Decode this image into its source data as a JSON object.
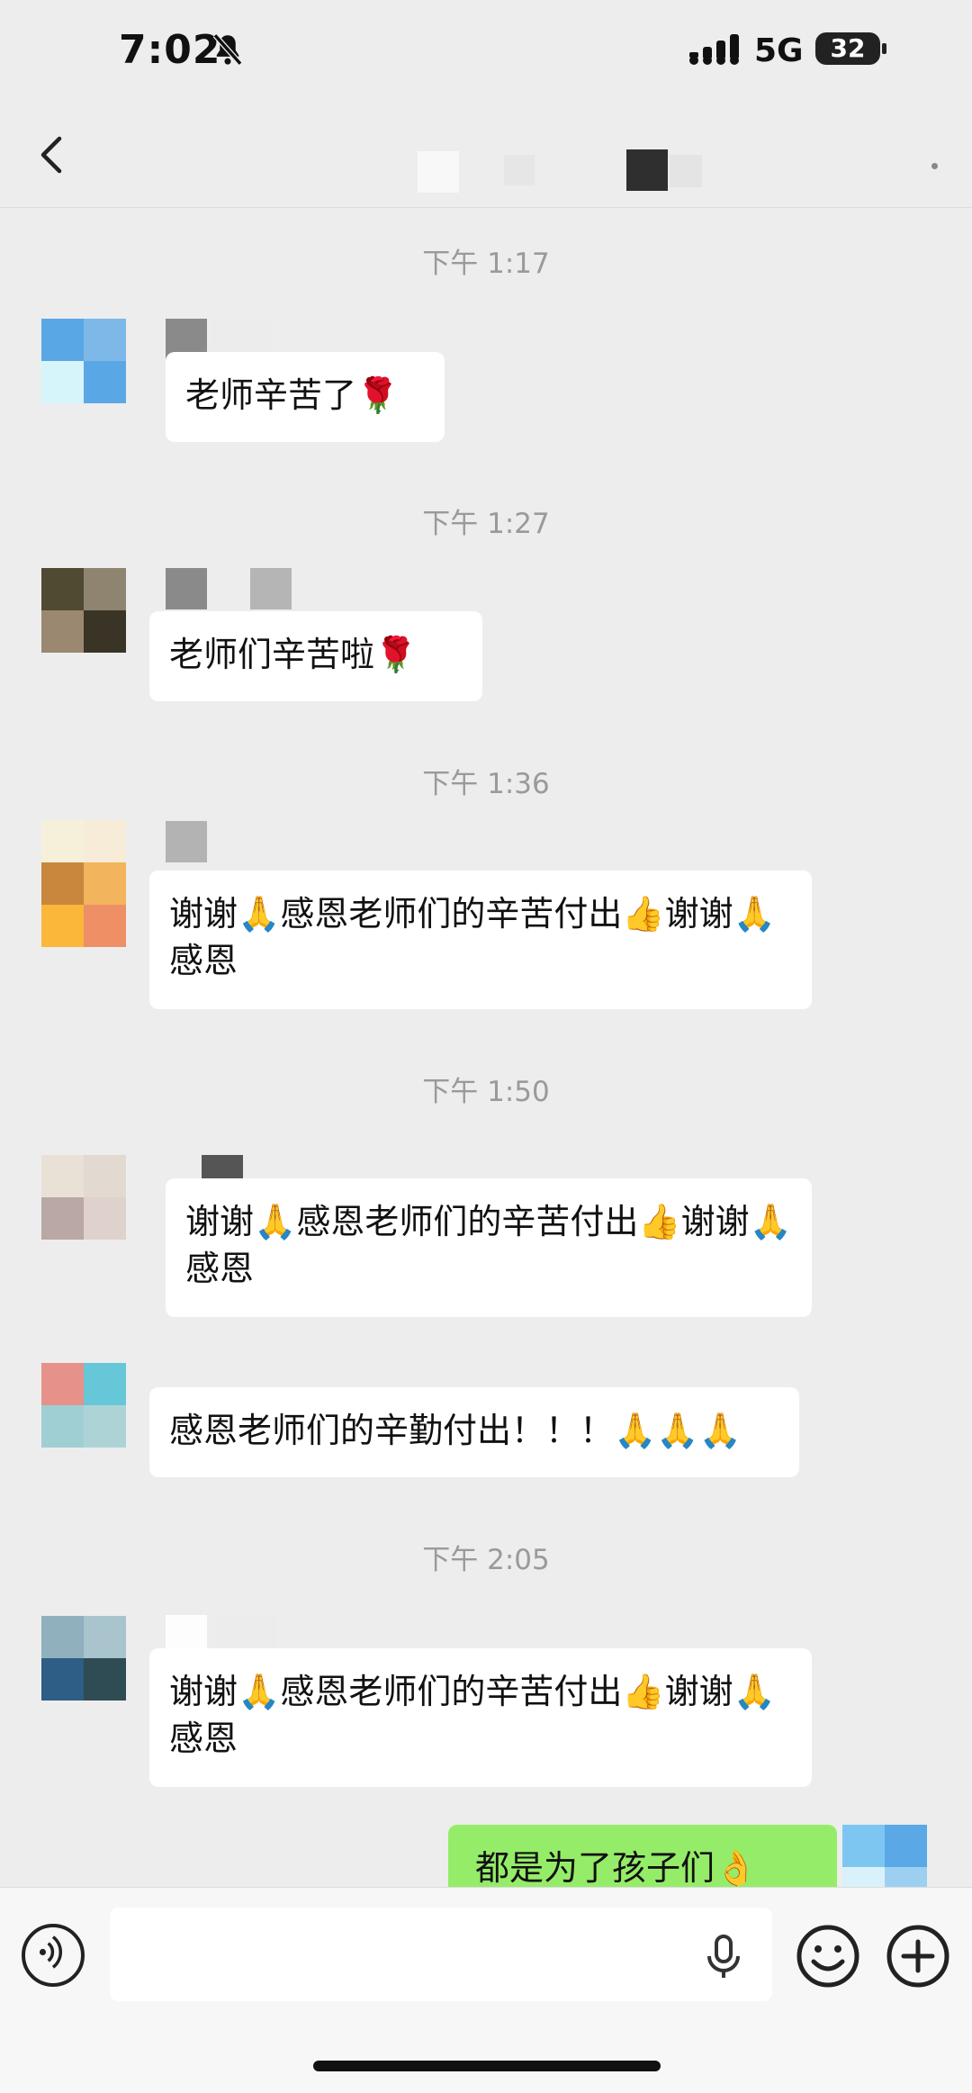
{
  "status_bar": {
    "time": "7:02",
    "network": "5G",
    "battery": "32"
  },
  "messages": [
    {
      "timestamp": "下午 1:17",
      "text": "老师辛苦了🌹"
    },
    {
      "timestamp": "下午 1:27",
      "text": "老师们辛苦啦🌹"
    },
    {
      "timestamp": "下午 1:36",
      "text": "谢谢🙏感恩老师们的辛苦付出👍谢谢🙏感恩"
    },
    {
      "timestamp": "下午 1:50",
      "text": "谢谢🙏感恩老师们的辛苦付出👍谢谢🙏感恩"
    },
    {
      "text": "感恩老师们的辛勤付出！！！🙏🙏🙏"
    },
    {
      "timestamp": "下午 2:05",
      "text": "谢谢🙏感恩老师们的辛苦付出👍谢谢🙏感恩"
    },
    {
      "text": "都是为了孩子们👌",
      "sender": "self"
    }
  ],
  "icons": {
    "back": "chevron-left-icon",
    "more": "more-dot-icon",
    "voice": "voice-icon",
    "mic": "mic-icon",
    "emoji": "emoji-icon",
    "plus": "plus-icon",
    "bell_off": "bell-off-icon"
  }
}
